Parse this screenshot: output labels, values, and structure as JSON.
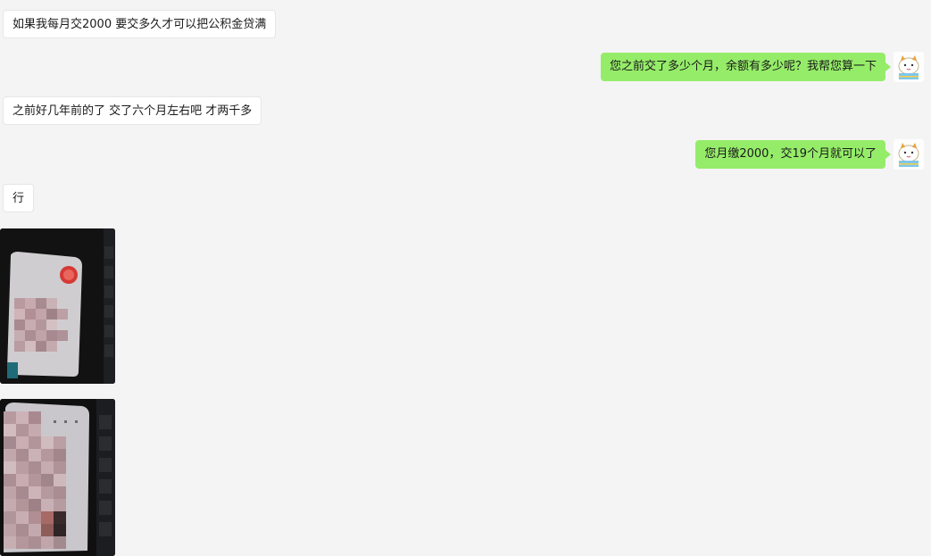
{
  "chat": {
    "messages": [
      {
        "side": "in",
        "type": "text",
        "text": "如果我每月交2000  要交多久才可以把公积金贷满"
      },
      {
        "side": "out",
        "type": "text",
        "text": "您之前交了多少个月，余额有多少呢？我帮您算一下"
      },
      {
        "side": "in",
        "type": "text",
        "text": "之前好几年前的了  交了六个月左右吧  才两千多"
      },
      {
        "side": "out",
        "type": "text",
        "text": "您月缴2000，交19个月就可以了"
      },
      {
        "side": "in",
        "type": "text",
        "text": "行"
      },
      {
        "side": "in",
        "type": "image",
        "content": "photo of a card with pixelated (mosaic) personal information and a red stamp"
      },
      {
        "side": "in",
        "type": "image",
        "content": "photo of a card with pixelated (mosaic) personal information, on a dark keyboard"
      }
    ]
  },
  "agent": {
    "avatar_icon": "cartoon-cat-avatar-icon"
  },
  "colors": {
    "background": "#f4f4f4",
    "incoming_bubble": "#ffffff",
    "outgoing_bubble": "#95ec69"
  }
}
